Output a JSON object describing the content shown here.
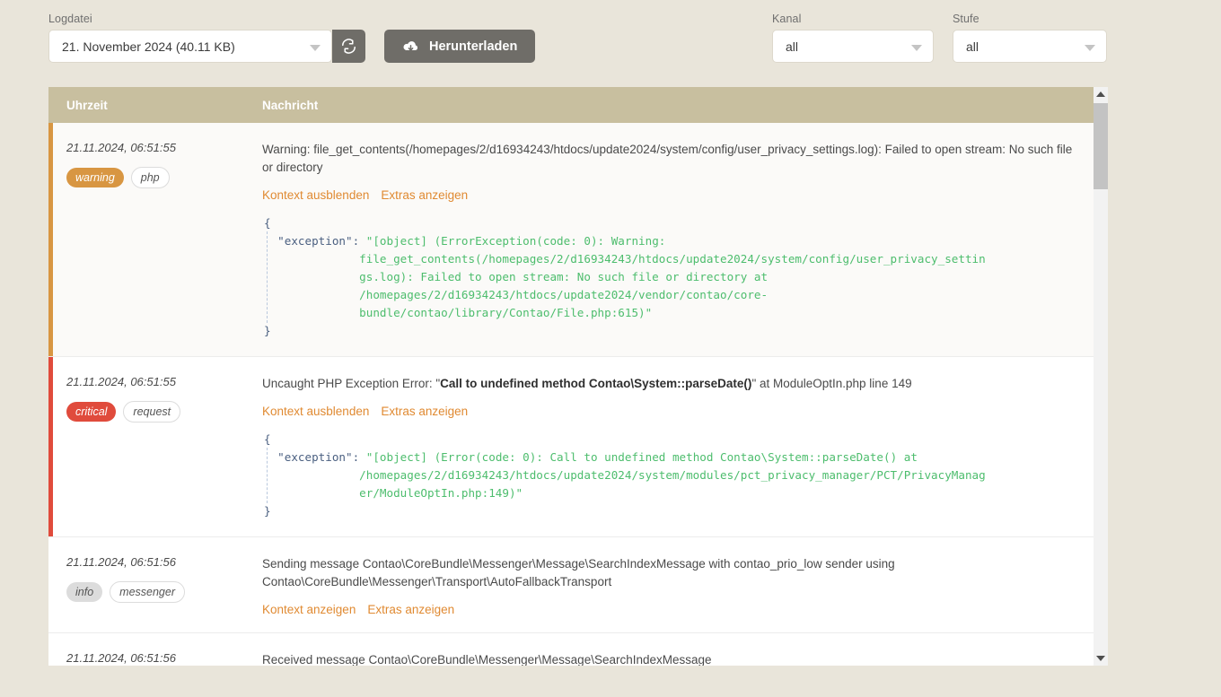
{
  "toolbar": {
    "logfile": {
      "label": "Logdatei",
      "value": "21. November 2024 (40.11 KB)",
      "refresh_icon": "refresh-icon"
    },
    "download": {
      "label": "Herunterladen",
      "icon": "cloud-download-icon"
    },
    "kanal": {
      "label": "Kanal",
      "value": "all"
    },
    "stufe": {
      "label": "Stufe",
      "value": "all"
    }
  },
  "table": {
    "headers": {
      "time": "Uhrzeit",
      "message": "Nachricht"
    },
    "rows": [
      {
        "timestamp": "21.11.2024, 06:51:55",
        "level": "warning",
        "channel": "php",
        "stripe_color": "#d89642",
        "message": "Warning: file_get_contents(/homepages/2/d16934243/htdocs/update2024/system/config/user_privacy_settings.log): Failed to open stream: No such file or directory",
        "message_bold": "",
        "message_tail": "",
        "context_link": "Kontext ausblenden",
        "extras_link": "Extras anzeigen",
        "code": "{\n  \"exception\": \"[object] (ErrorException(code: 0): Warning:\n              file_get_contents(/homepages/2/d16934243/htdocs/update2024/system/config/user_privacy_settin\n              gs.log): Failed to open stream: No such file or directory at\n              /homepages/2/d16934243/htdocs/update2024/vendor/contao/core-\n              bundle/contao/library/Contao/File.php:615)\"\n}"
      },
      {
        "timestamp": "21.11.2024, 06:51:55",
        "level": "critical",
        "channel": "request",
        "stripe_color": "#e04b3c",
        "message": "Uncaught PHP Exception Error: \"",
        "message_bold": "Call to undefined method Contao\\System::parseDate()",
        "message_tail": "\" at ModuleOptIn.php line 149",
        "context_link": "Kontext ausblenden",
        "extras_link": "Extras anzeigen",
        "code": "{\n  \"exception\": \"[object] (Error(code: 0): Call to undefined method Contao\\System::parseDate() at\n              /homepages/2/d16934243/htdocs/update2024/system/modules/pct_privacy_manager/PCT/PrivacyManag\n              er/ModuleOptIn.php:149)\"\n}"
      },
      {
        "timestamp": "21.11.2024, 06:51:56",
        "level": "info",
        "channel": "messenger",
        "stripe_color": "",
        "message": "Sending message Contao\\CoreBundle\\Messenger\\Message\\SearchIndexMessage with contao_prio_low sender using Contao\\CoreBundle\\Messenger\\Transport\\AutoFallbackTransport",
        "message_bold": "",
        "message_tail": "",
        "context_link": "Kontext anzeigen",
        "extras_link": "Extras anzeigen",
        "code": ""
      },
      {
        "timestamp": "21.11.2024, 06:51:56",
        "level": "",
        "channel": "",
        "stripe_color": "",
        "message": "Received message Contao\\CoreBundle\\Messenger\\Message\\SearchIndexMessage",
        "message_bold": "",
        "message_tail": "",
        "context_link": "",
        "extras_link": "",
        "code": ""
      }
    ]
  },
  "colors": {
    "page_background": "#e9e5da",
    "header_background": "#c8bf9f",
    "accent_link": "#e08a32",
    "button_background": "#6f6d68",
    "code_string": "#4dbd6d"
  }
}
